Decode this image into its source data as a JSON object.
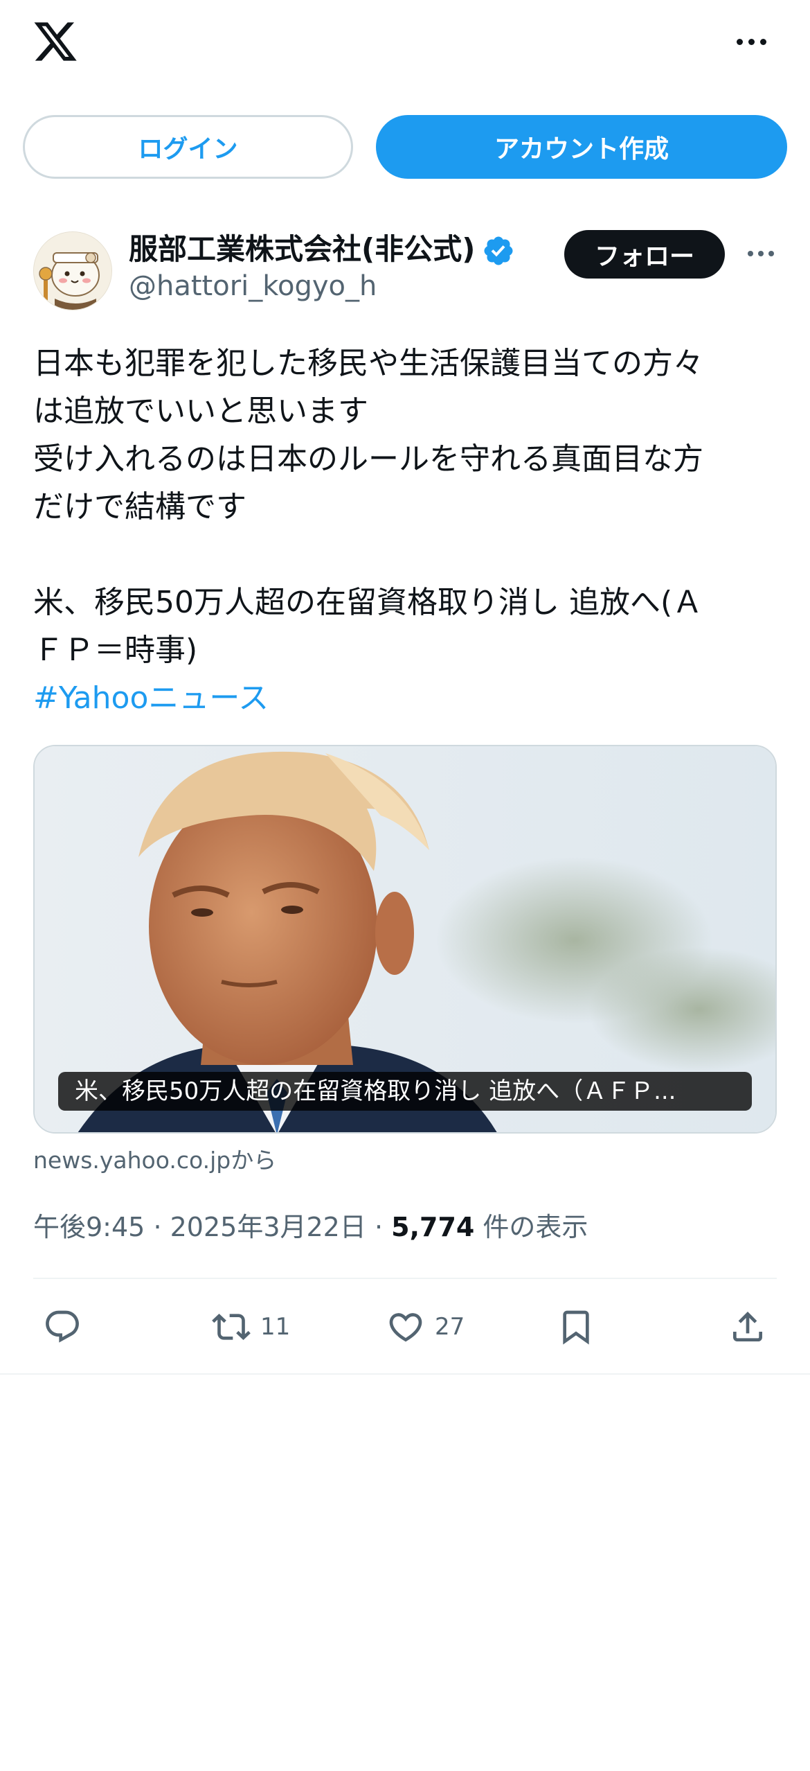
{
  "header": {
    "logo": "x-logo-icon",
    "more_icon": "more-horizontal-icon"
  },
  "auth": {
    "login_label": "ログイン",
    "signup_label": "アカウント作成"
  },
  "author": {
    "name": "服部工業株式会社(非公式)",
    "handle": "@hattori_kogyo_h",
    "verified_icon": "verified-badge-icon",
    "follow_label": "フォロー"
  },
  "post": {
    "lines": [
      "日本も犯罪を犯した移民や生活保護目当ての方々",
      "は追放でいいと思います",
      "受け入れるのは日本のルールを守れる真面目な方",
      "だけで結構です",
      "",
      "米、移民50万人超の在留資格取り消し 追放へ(Ａ",
      "ＦＰ＝時事)"
    ],
    "hashtag": "#Yahooニュース"
  },
  "card": {
    "caption": "米、移民50万人超の在留資格取り消し 追放へ（ＡＦＰ...",
    "source": "news.yahoo.co.jpから"
  },
  "meta": {
    "time": "午後9:45",
    "date": "2025年3月22日",
    "views_count": "5,774",
    "views_label": "件の表示"
  },
  "actions": {
    "reply_icon": "reply-icon",
    "repost_icon": "repost-icon",
    "repost_count": "11",
    "like_icon": "heart-icon",
    "like_count": "27",
    "bookmark_icon": "bookmark-icon",
    "share_icon": "share-icon"
  },
  "colors": {
    "accent": "#1d9bf0",
    "text": "#0f1419",
    "secondary": "#536471",
    "border": "#cfd9de"
  }
}
